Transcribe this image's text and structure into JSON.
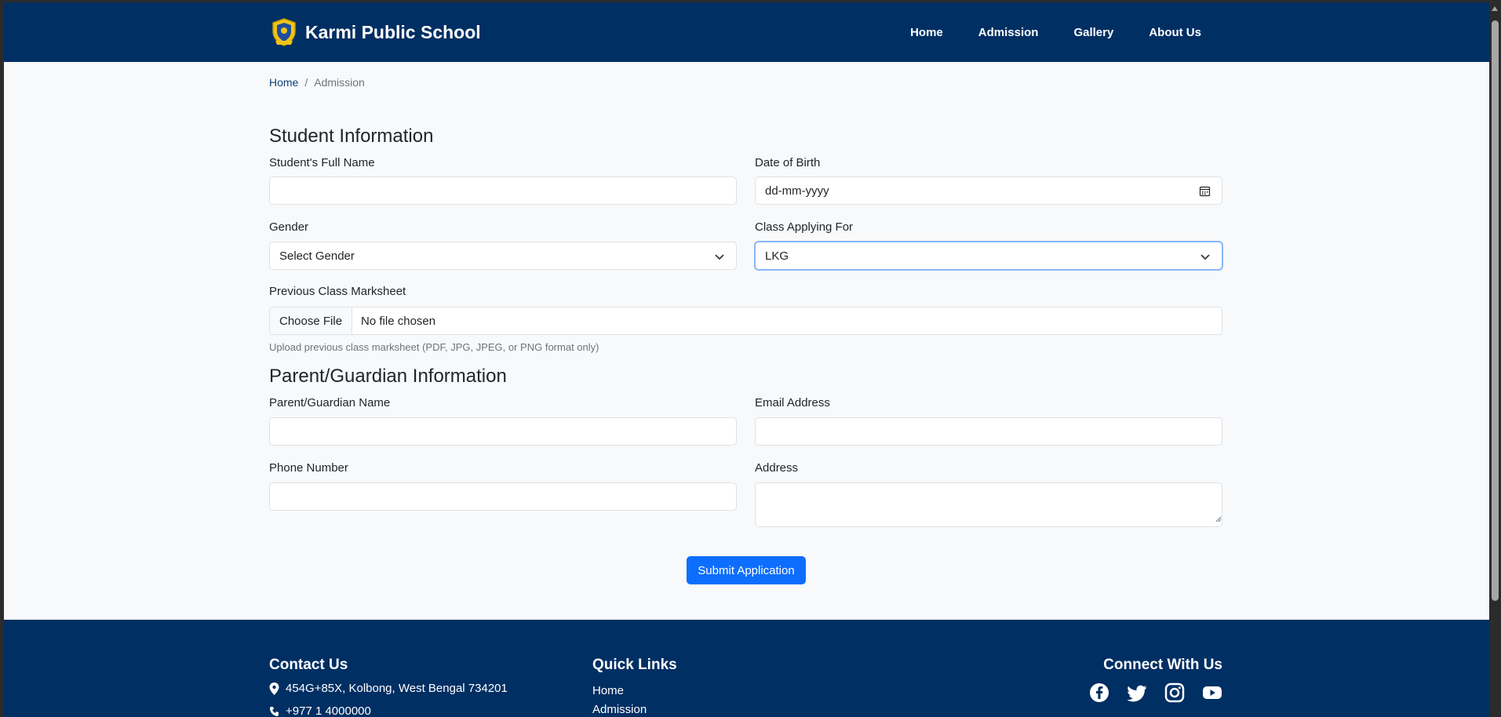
{
  "brand": {
    "name": "Karmi Public School",
    "logo": "school-crest-logo"
  },
  "nav": {
    "items": [
      "Home",
      "Admission",
      "Gallery",
      "About Us"
    ]
  },
  "breadcrumb": {
    "home": "Home",
    "separator": "/",
    "current": "Admission"
  },
  "student": {
    "title": "Student Information",
    "name_label": "Student's Full Name",
    "name_value": "",
    "dob_label": "Date of Birth",
    "dob_placeholder": "dd-mm-yyyy",
    "gender_label": "Gender",
    "gender_value": "Select Gender",
    "class_label": "Class Applying For",
    "class_value": "LKG",
    "marksheet_label": "Previous Class Marksheet",
    "file_button": "Choose File",
    "file_status": "No file chosen",
    "file_help": "Upload previous class marksheet (PDF, JPG, JPEG, or PNG format only)"
  },
  "parent": {
    "title": "Parent/Guardian Information",
    "name_label": "Parent/Guardian Name",
    "email_label": "Email Address",
    "phone_label": "Phone Number",
    "address_label": "Address"
  },
  "submit_label": "Submit Application",
  "footer": {
    "contact_title": "Contact Us",
    "address": "454G+85X, Kolbong, West Bengal 734201",
    "phone_partial": "+977 1 4000000",
    "quick_links_title": "Quick Links",
    "quick_links": [
      "Home",
      "Admission"
    ],
    "connect_title": "Connect With Us",
    "social_icons": [
      "facebook-icon",
      "twitter-icon",
      "instagram-icon",
      "youtube-icon"
    ]
  },
  "colors": {
    "navbar": "#002f63",
    "primary": "#0d6efd",
    "page_bg": "#f8f9fa"
  }
}
